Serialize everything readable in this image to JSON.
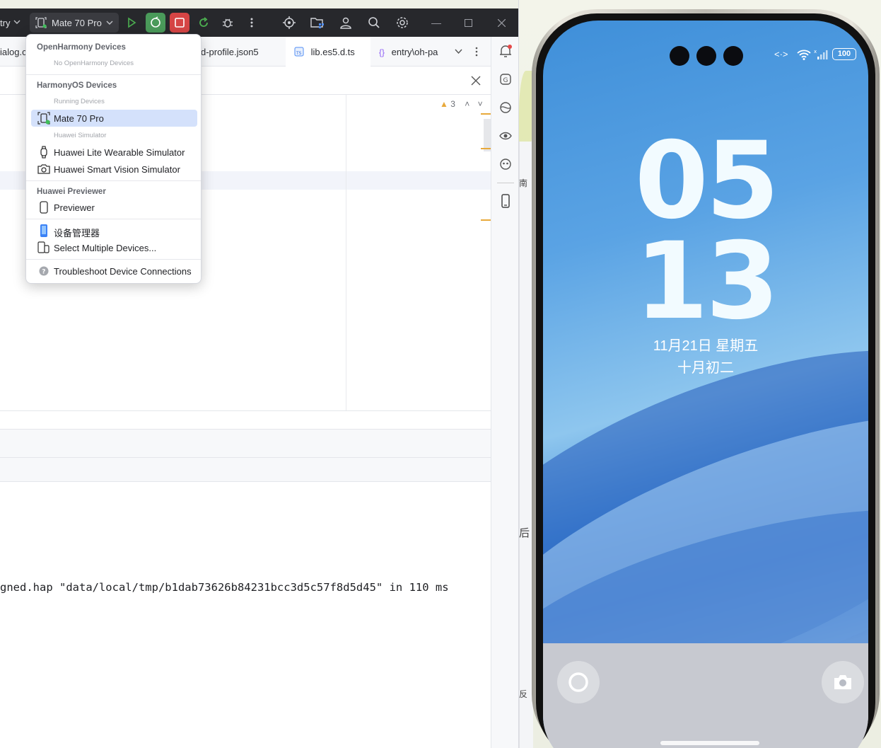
{
  "toolbar": {
    "module_label": "try",
    "device_label": "Mate 70 Pro",
    "colors": {
      "run": "#4caf50",
      "stop": "#d64545",
      "reload_bg": "#4a9a5a"
    }
  },
  "tabs": [
    {
      "label": "ialog.c"
    },
    {
      "label": "d-profile.json5"
    },
    {
      "label": "lib.es5.d.ts"
    },
    {
      "label": "entry\\oh-pa"
    }
  ],
  "editor": {
    "warning_count": "3"
  },
  "dropdown": {
    "sections": {
      "openharmony": {
        "title": "OpenHarmony Devices",
        "empty": "No OpenHarmony Devices"
      },
      "harmonyos": {
        "title": "HarmonyOS Devices",
        "running": "Running Devices",
        "simulator": "Huawei Simulator"
      },
      "previewer": {
        "title": "Huawei Previewer"
      }
    },
    "items": {
      "mate": "Mate 70 Pro",
      "wearable": "Huawei Lite Wearable Simulator",
      "vision": "Huawei Smart Vision Simulator",
      "previewer": "Previewer",
      "device_manager": "设备管理器",
      "select_multiple": "Select Multiple Devices...",
      "troubleshoot": "Troubleshoot Device Connections"
    }
  },
  "console": {
    "line": "gned.hap \"data/local/tmp/b1dab73626b84231bcc3d5c57f8d5d45\" in 110 ms"
  },
  "behind_window": {
    "t1": "南",
    "t2": "后",
    "t3": "反"
  },
  "phone": {
    "battery": "100",
    "hour": "05",
    "minute": "13",
    "date": "11月21日  星期五",
    "lunar": "十月初二"
  }
}
